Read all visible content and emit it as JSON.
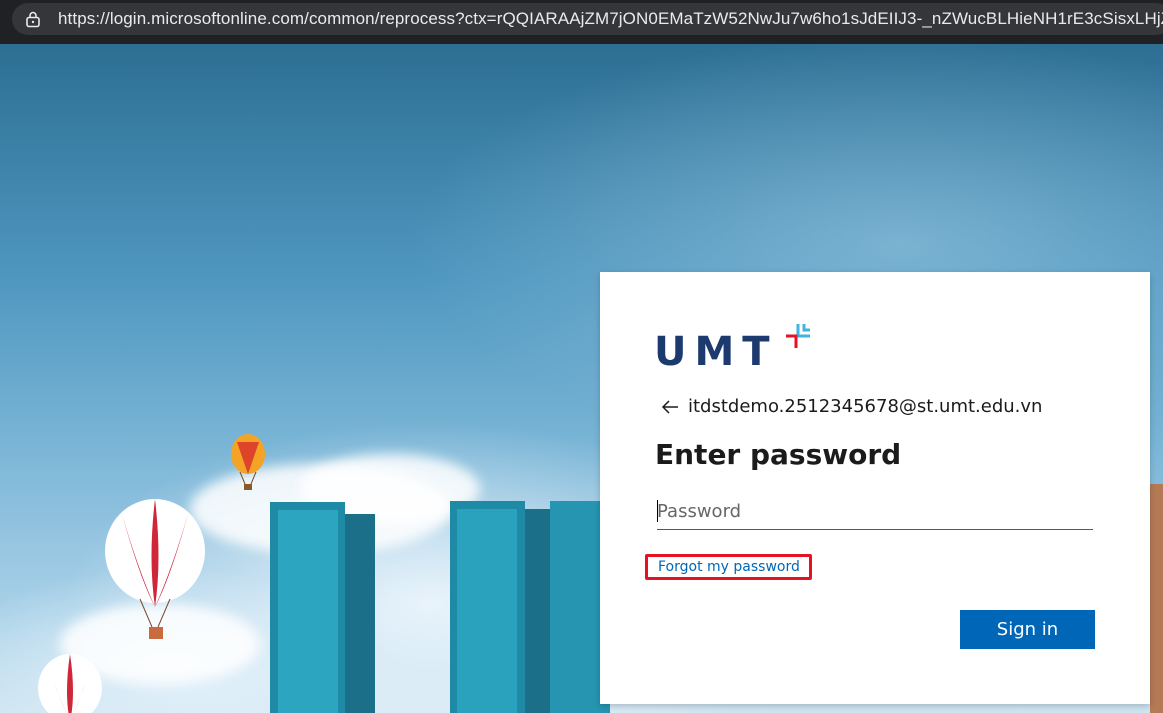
{
  "browser": {
    "url": "https://login.microsoftonline.com/common/reprocess?ctx=rQQIARAAjZM7jON0EMaTzW52NwJu7w6ho1sJdEIIJ3-_nZWucBLHieNH1rE3cSisxLHjZ"
  },
  "login": {
    "logo_text": "UMT",
    "account_email": "itdstdemo.2512345678@st.umt.edu.vn",
    "heading": "Enter password",
    "password_placeholder": "Password",
    "password_value": "",
    "forgot_link": "Forgot my password",
    "signin_button": "Sign in"
  },
  "icons": {
    "address_bar": "lock-icon",
    "back": "back-arrow-icon"
  },
  "colors": {
    "accent": "#0067b8",
    "logo_navy": "#1d3a6e",
    "highlight_border": "#e81123"
  }
}
